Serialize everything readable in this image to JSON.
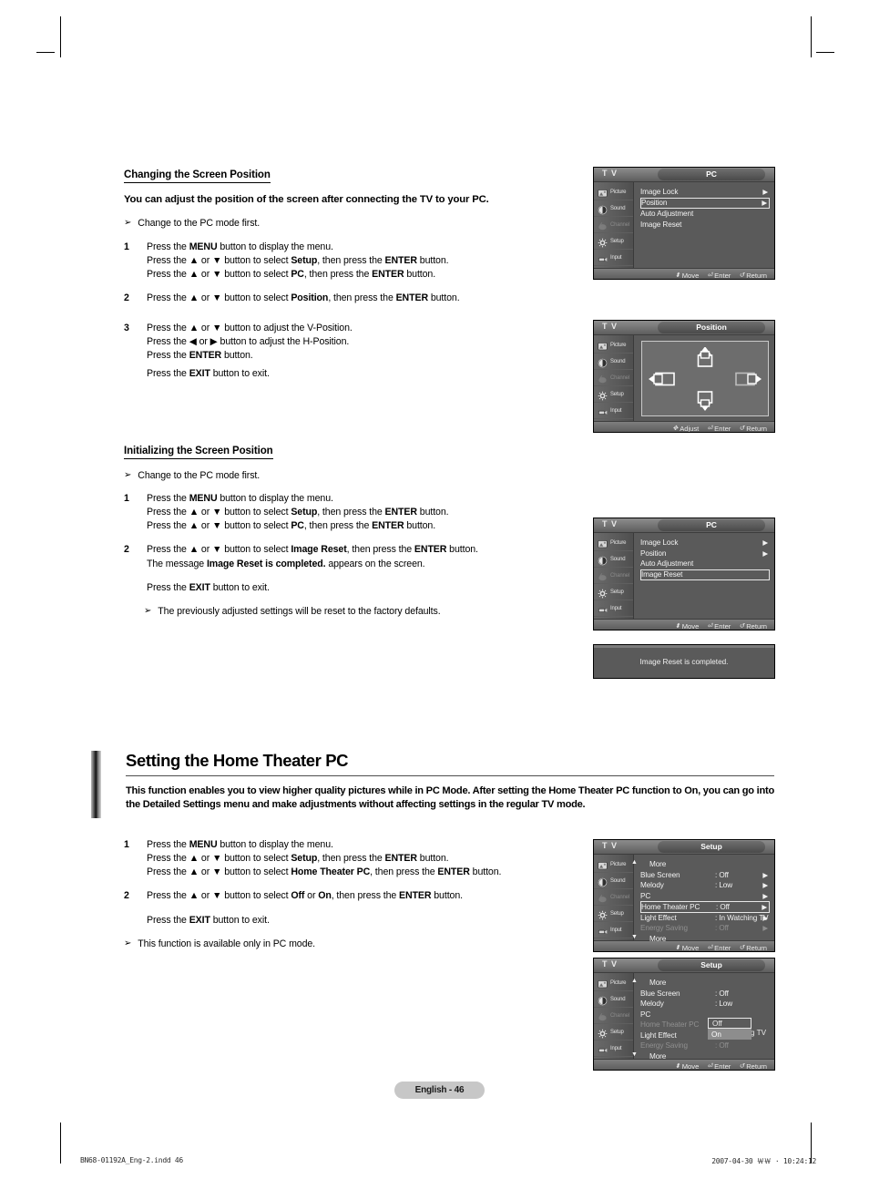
{
  "page": {
    "badge": "English - 46",
    "footer_left": "BN68-01192A_Eng-2.indd   46",
    "footer_right": "2007-04-30   ￦￦ · 10:24:12"
  },
  "section1": {
    "heading": "Changing the Screen Position",
    "intro": "You can adjust the position of the screen after connecting the TV to your PC.",
    "note": "Change to the PC mode first.",
    "steps": [
      {
        "num": "1",
        "lines": [
          "Press the <b>MENU</b> button to display the menu.",
          "Press the ▲ or ▼ button to select <b>Setup</b>, then press the <b>ENTER</b> button.",
          "Press the ▲ or ▼ button to select <b>PC</b>, then press the <b>ENTER</b> button."
        ]
      },
      {
        "num": "2",
        "lines": [
          "Press the ▲ or ▼ button to select <b>Position</b>, then press the <b>ENTER</b> button."
        ]
      },
      {
        "num": "3",
        "lines": [
          "Press the ▲ or ▼ button to adjust the V-Position.",
          "Press the ◀ or ▶ button to adjust the H-Position.",
          "Press the <b>ENTER</b> button."
        ]
      }
    ],
    "exit": "Press the <b>EXIT</b> button to exit."
  },
  "section2": {
    "heading": "Initializing the Screen Position",
    "note": "Change to the PC mode first.",
    "steps": [
      {
        "num": "1",
        "lines": [
          "Press the <b>MENU</b> button to display the menu.",
          "Press the ▲ or ▼ button to select <b>Setup</b>, then press the <b>ENTER</b> button.",
          "Press the ▲ or ▼ button to select <b>PC</b>, then press the <b>ENTER</b> button."
        ]
      },
      {
        "num": "2",
        "lines": [
          "Press the ▲ or ▼ button to select <b>Image Reset</b>, then press the <b>ENTER</b> button.",
          "The message <b>Image Reset is completed.</b> appears on the screen."
        ]
      }
    ],
    "exit": "Press the <b>EXIT</b> button to exit.",
    "note2": "The previously adjusted settings will be reset to the factory defaults."
  },
  "section3": {
    "heading": "Setting the Home Theater PC",
    "intro": "This function enables you to view higher quality pictures while in PC Mode. After setting the Home Theater PC function to On, you can go into the Detailed Settings menu and make adjustments without affecting settings in the regular TV mode.",
    "steps": [
      {
        "num": "1",
        "lines": [
          "Press the <b>MENU</b> button to display the menu.",
          "Press the ▲ or ▼ button to select <b>Setup</b>, then press the <b>ENTER</b> button.",
          "Press the ▲ or ▼ button to select <b>Home Theater PC</b>, then press the <b>ENTER</b> button."
        ]
      },
      {
        "num": "2",
        "lines": [
          "Press the ▲ or ▼ button to select <b>Off</b> or <b>On</b>, then press the <b>ENTER</b> button."
        ]
      }
    ],
    "exit": "Press the <b>EXIT</b> button to exit.",
    "note": "This function is available only in PC mode."
  },
  "osd_common": {
    "brand": "T V",
    "sidebar": [
      {
        "label": "Picture",
        "icon": "picture-icon",
        "dim": false
      },
      {
        "label": "Sound",
        "icon": "sound-icon",
        "dim": false
      },
      {
        "label": "Channel",
        "icon": "channel-icon",
        "dim": true
      },
      {
        "label": "Setup",
        "icon": "setup-icon",
        "dim": false
      },
      {
        "label": "Input",
        "icon": "input-icon",
        "dim": false
      }
    ],
    "nav_move": "Move",
    "nav_enter": "Enter",
    "nav_return": "Return",
    "nav_adjust": "Adjust"
  },
  "osd1": {
    "title": "PC",
    "rows": [
      {
        "name": "Image Lock",
        "val": "",
        "arrow": "▶",
        "selected": false,
        "dim": false
      },
      {
        "name": "Position",
        "val": "",
        "arrow": "▶",
        "selected": true,
        "dim": false
      },
      {
        "name": "Auto Adjustment",
        "val": "",
        "arrow": "",
        "selected": false,
        "dim": false
      },
      {
        "name": "Image Reset",
        "val": "",
        "arrow": "",
        "selected": false,
        "dim": false
      }
    ]
  },
  "osd2": {
    "title": "Position",
    "icons": [
      "up-adjust-icon",
      "left-adjust-icon",
      "right-adjust-icon",
      "down-adjust-icon"
    ]
  },
  "osd3": {
    "title": "PC",
    "rows": [
      {
        "name": "Image Lock",
        "val": "",
        "arrow": "▶",
        "selected": false,
        "dim": false
      },
      {
        "name": "Position",
        "val": "",
        "arrow": "▶",
        "selected": false,
        "dim": false
      },
      {
        "name": "Auto Adjustment",
        "val": "",
        "arrow": "",
        "selected": false,
        "dim": false
      },
      {
        "name": "Image Reset",
        "val": "",
        "arrow": "",
        "selected": true,
        "dim": false
      }
    ]
  },
  "msgbox": {
    "text": "Image Reset is completed."
  },
  "osd4": {
    "title": "Setup",
    "more_up": "More",
    "more_down": "More",
    "rows": [
      {
        "name": "Blue Screen",
        "val": ": Off",
        "arrow": "▶",
        "selected": false,
        "dim": false
      },
      {
        "name": "Melody",
        "val": ": Low",
        "arrow": "▶",
        "selected": false,
        "dim": false
      },
      {
        "name": "PC",
        "val": "",
        "arrow": "▶",
        "selected": false,
        "dim": false
      },
      {
        "name": "Home Theater PC",
        "val": ": Off",
        "arrow": "▶",
        "selected": true,
        "dim": false
      },
      {
        "name": "Light Effect",
        "val": ": In Watching TV",
        "arrow": "▶",
        "selected": false,
        "dim": false
      },
      {
        "name": "Energy Saving",
        "val": ": Off",
        "arrow": "▶",
        "selected": false,
        "dim": true
      }
    ]
  },
  "osd5": {
    "title": "Setup",
    "more_up": "More",
    "more_down": "More",
    "rows": [
      {
        "name": "Blue Screen",
        "val": ": Off",
        "arrow": "",
        "selected": false,
        "dim": false
      },
      {
        "name": "Melody",
        "val": ": Low",
        "arrow": "",
        "selected": false,
        "dim": false
      },
      {
        "name": "PC",
        "val": "",
        "arrow": "",
        "selected": false,
        "dim": false
      },
      {
        "name": "Home Theater PC",
        "val": ":",
        "arrow": "",
        "selected": false,
        "dim": true
      },
      {
        "name": "Light Effect",
        "val": ":",
        "arrow": "",
        "selected": false,
        "dim": false
      },
      {
        "name": "Energy Saving",
        "val": ": Off",
        "arrow": "",
        "selected": false,
        "dim": true
      }
    ],
    "light_effect_tail": "g TV",
    "dropdown": {
      "option_off": "Off",
      "option_on": "On",
      "selected": "On"
    }
  }
}
